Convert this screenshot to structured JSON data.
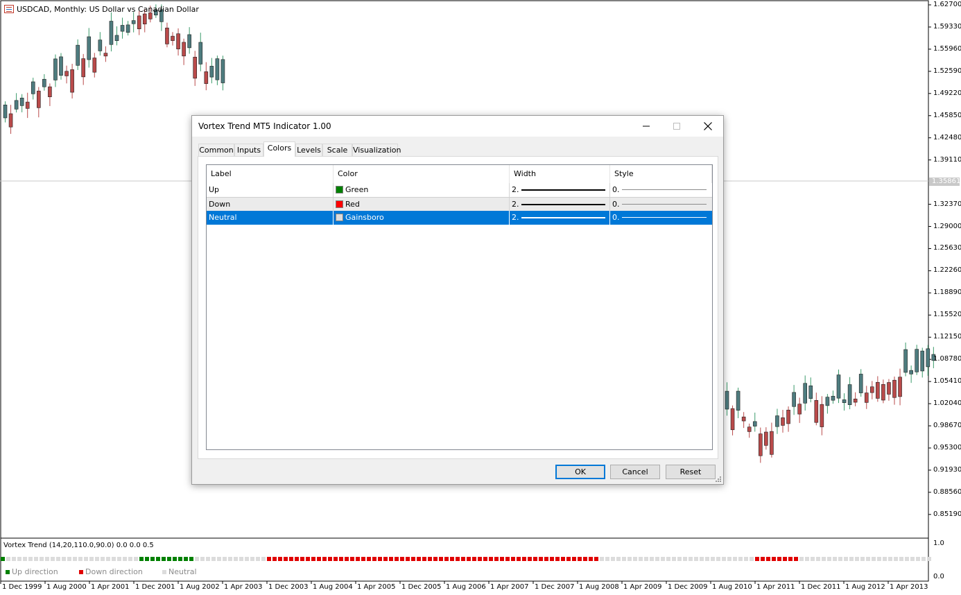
{
  "chart": {
    "title": "USDCAD, Monthly:  US Dollar vs Canadian Dollar",
    "current_price": "1.35861",
    "price_labels": [
      "1.62700",
      "1.59330",
      "1.55960",
      "1.52590",
      "1.49220",
      "1.45850",
      "1.42480",
      "1.39110",
      "1.32370",
      "1.29000",
      "1.25630",
      "1.22260",
      "1.18890",
      "1.15520",
      "1.12150",
      "1.08780",
      "1.05410",
      "1.02040",
      "0.98670",
      "0.95300",
      "0.91930",
      "0.88560",
      "0.85190"
    ],
    "date_labels": [
      "1 Dec 1999",
      "1 Aug 2000",
      "1 Apr 2001",
      "1 Dec 2001",
      "1 Aug 2002",
      "1 Apr 2003",
      "1 Dec 2003",
      "1 Aug 2004",
      "1 Apr 2005",
      "1 Dec 2005",
      "1 Aug 2006",
      "1 Apr 2007",
      "1 Dec 2007",
      "1 Aug 2008",
      "1 Apr 2009",
      "1 Dec 2009",
      "1 Aug 2010",
      "1 Apr 2011",
      "1 Dec 2011",
      "1 Aug 2012",
      "1 Apr 2013"
    ],
    "colors": {
      "bull": "#4e7c7f",
      "bear": "#b94a4a",
      "wick_up": "#3a9a6a",
      "wick_down": "#b94a4a"
    }
  },
  "subwindow": {
    "title": "Vortex Trend (14,20,110.0,90.0) 0.0 0.0 0.5",
    "scale_top": "1.0",
    "scale_bottom": "0.0",
    "legend": [
      {
        "label": "Up direction",
        "color": "#008000"
      },
      {
        "label": "Down direction",
        "color": "#e00000"
      },
      {
        "label": "Neutral",
        "color": "#dcdcdc"
      }
    ]
  },
  "dialog": {
    "title": "Vortex Trend MT5 Indicator 1.00",
    "tabs": [
      "Common",
      "Inputs",
      "Colors",
      "Levels",
      "Scale",
      "Visualization"
    ],
    "active_tab": "Colors",
    "columns": [
      "Label",
      "Color",
      "Width",
      "Style"
    ],
    "rows": [
      {
        "label": "Up",
        "color_name": "Green",
        "color": "#008000",
        "width": "2.",
        "style": "0."
      },
      {
        "label": "Down",
        "color_name": "Red",
        "color": "#ff0000",
        "width": "2.",
        "style": "0."
      },
      {
        "label": "Neutral",
        "color_name": "Gainsboro",
        "color": "#dcdcdc",
        "width": "2.",
        "style": "0."
      }
    ],
    "selected_row": 2,
    "buttons": {
      "ok": "OK",
      "cancel": "Cancel",
      "reset": "Reset"
    }
  }
}
